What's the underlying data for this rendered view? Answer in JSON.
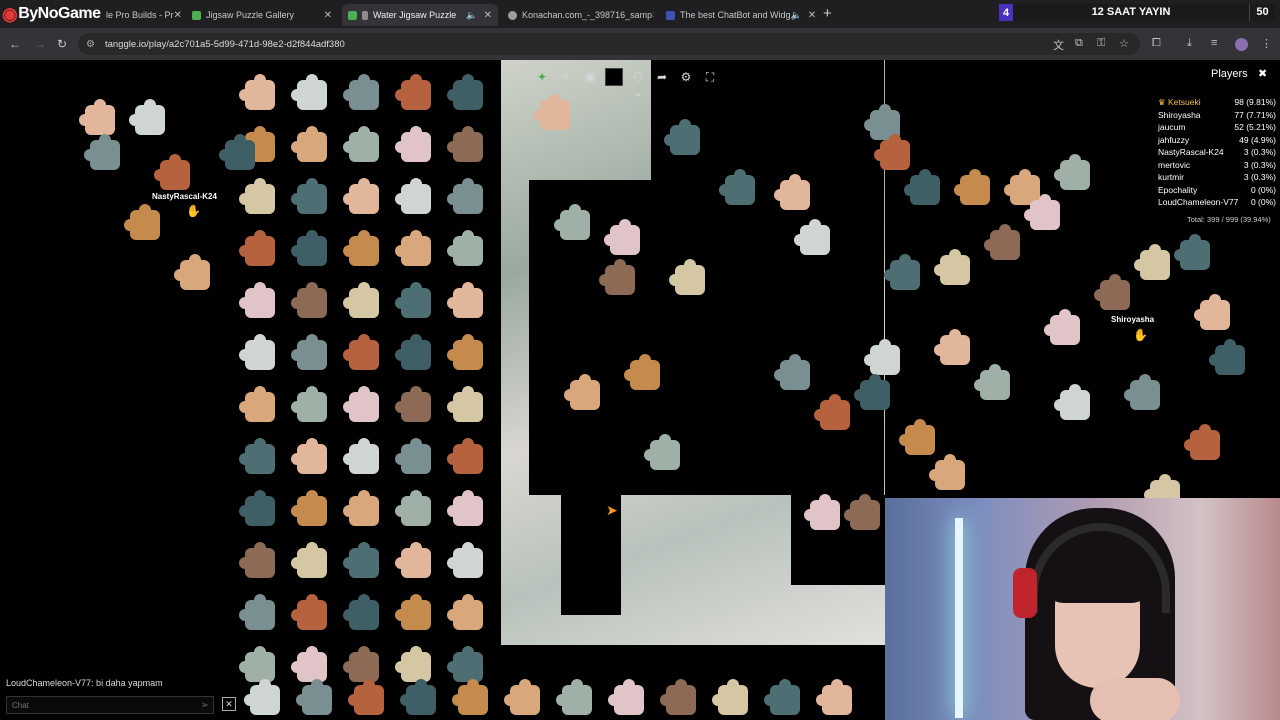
{
  "browser": {
    "logo": "ByNoGame",
    "tabs": [
      {
        "label": "le Pro Builds - Pr",
        "active": false,
        "color": "#6b7a8f"
      },
      {
        "label": "Jigsaw Puzzle Gallery",
        "active": false,
        "color": "#4caf50"
      },
      {
        "label": "Water Jigsaw Puzzle",
        "active": true,
        "color": "#4caf50"
      },
      {
        "label": "Konachan.com_-_398716_samp",
        "active": false,
        "color": "#9e9e9e"
      },
      {
        "label": "The best ChatBot and Widg",
        "active": false,
        "color": "#3f51b5"
      }
    ],
    "counter": {
      "number": "4",
      "title": "12 SAAT YAYIN",
      "value": "50"
    },
    "url": "tanggle.io/play/a2c701a5-5d99-471d-98e2-d2f844adf380"
  },
  "game": {
    "labels": {
      "nasty": "NastyRascal-K24",
      "shiro": "Shiroyasha"
    },
    "players_header": "Players",
    "players": [
      {
        "name": "Ketsueki",
        "score": "98 (9.81%)"
      },
      {
        "name": "Shiroyasha",
        "score": "77 (7.71%)"
      },
      {
        "name": "jaucum",
        "score": "52 (5.21%)"
      },
      {
        "name": "jahfuzzy",
        "score": "49 (4.9%)"
      },
      {
        "name": "NastyRascal-K24",
        "score": "3 (0.3%)"
      },
      {
        "name": "mertovic",
        "score": "3 (0.3%)"
      },
      {
        "name": "kurtmir",
        "score": "3 (0.3%)"
      },
      {
        "name": "Epochality",
        "score": "0 (0%)"
      },
      {
        "name": "LoudChameleon-V77",
        "score": "0 (0%)"
      }
    ],
    "total": "Total: 399 / 999 (39.94%)",
    "chat": {
      "message": "LoudChameleon-V77: bi daha yapmam",
      "placeholder": "Chat"
    }
  }
}
